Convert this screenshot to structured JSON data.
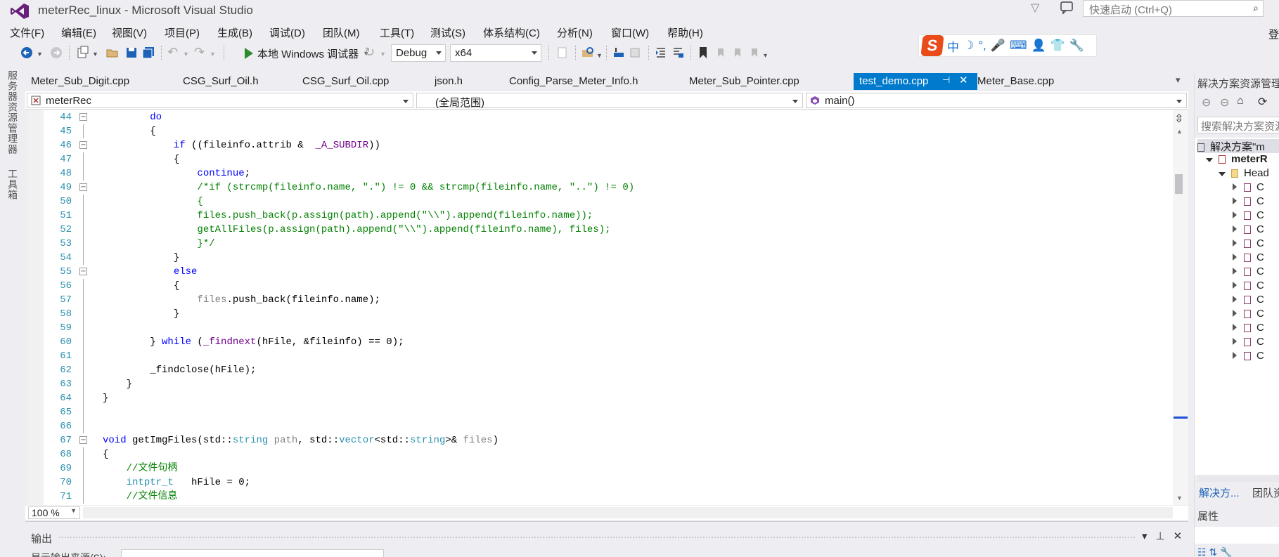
{
  "window": {
    "title": "meterRec_linux - Microsoft Visual Studio",
    "quick_launch_placeholder": "快速启动 (Ctrl+Q)",
    "account_char": "登"
  },
  "menu": [
    "文件(F)",
    "编辑(E)",
    "视图(V)",
    "项目(P)",
    "生成(B)",
    "调试(D)",
    "团队(M)",
    "工具(T)",
    "测试(S)",
    "体系结构(C)",
    "分析(N)",
    "窗口(W)",
    "帮助(H)"
  ],
  "toolbar": {
    "run_label": "本地 Windows 调试器",
    "config": "Debug",
    "platform": "x64"
  },
  "ime": {
    "logo": "S",
    "glyphs": [
      "中",
      "☽",
      "°,",
      "🎤",
      "⌨",
      "👤",
      "👕",
      "🔧"
    ]
  },
  "left_strip": {
    "server_explorer": "服务器资源管理器",
    "toolbox": "工具箱"
  },
  "doc_tabs": [
    {
      "label": "Meter_Sub_Digit.cpp",
      "active": false
    },
    {
      "label": "CSG_Surf_Oil.h",
      "active": false
    },
    {
      "label": "CSG_Surf_Oil.cpp",
      "active": false
    },
    {
      "label": "json.h",
      "active": false
    },
    {
      "label": "Config_Parse_Meter_Info.h",
      "active": false
    },
    {
      "label": "Meter_Sub_Pointer.cpp",
      "active": false
    },
    {
      "label": "test_demo.cpp",
      "active": true
    },
    {
      "label": "Meter_Base.cpp",
      "active": false
    }
  ],
  "nav_bar": {
    "project": "meterRec",
    "scope": "(全局范围)",
    "member": "main()"
  },
  "code_lines": [
    {
      "n": "44",
      "tokens": [
        [
          "kw",
          "        do"
        ]
      ]
    },
    {
      "n": "45",
      "tokens": [
        [
          "tx",
          "        {"
        ]
      ]
    },
    {
      "n": "46",
      "tokens": [
        [
          "tx",
          "            "
        ],
        [
          "kw",
          "if"
        ],
        [
          "tx",
          " ((fileinfo.attrib &  "
        ],
        [
          "mc",
          "_A_SUBDIR"
        ],
        [
          "tx",
          "))"
        ]
      ]
    },
    {
      "n": "47",
      "tokens": [
        [
          "tx",
          "            {"
        ]
      ]
    },
    {
      "n": "48",
      "tokens": [
        [
          "tx",
          "                "
        ],
        [
          "kw",
          "continue"
        ],
        [
          "tx",
          ";"
        ]
      ]
    },
    {
      "n": "49",
      "tokens": [
        [
          "cm",
          "                /*if (strcmp(fileinfo.name, \".\") != 0 && strcmp(fileinfo.name, \"..\") != 0)"
        ]
      ]
    },
    {
      "n": "50",
      "tokens": [
        [
          "cm",
          "                {"
        ]
      ]
    },
    {
      "n": "51",
      "tokens": [
        [
          "cm",
          "                files.push_back(p.assign(path).append(\"\\\\\").append(fileinfo.name));"
        ]
      ]
    },
    {
      "n": "52",
      "tokens": [
        [
          "cm",
          "                getAllFiles(p.assign(path).append(\"\\\\\").append(fileinfo.name), files);"
        ]
      ]
    },
    {
      "n": "53",
      "tokens": [
        [
          "cm",
          "                }*/"
        ]
      ]
    },
    {
      "n": "54",
      "tokens": [
        [
          "tx",
          "            }"
        ]
      ]
    },
    {
      "n": "55",
      "tokens": [
        [
          "tx",
          "            "
        ],
        [
          "kw",
          "else"
        ]
      ]
    },
    {
      "n": "56",
      "tokens": [
        [
          "tx",
          "            {"
        ]
      ]
    },
    {
      "n": "57",
      "tokens": [
        [
          "tx",
          "                "
        ],
        [
          "gr",
          "files"
        ],
        [
          "tx",
          ".push_back(fileinfo.name);"
        ]
      ]
    },
    {
      "n": "58",
      "tokens": [
        [
          "tx",
          "            }"
        ]
      ]
    },
    {
      "n": "59",
      "tokens": [
        [
          "tx",
          ""
        ]
      ]
    },
    {
      "n": "60",
      "tokens": [
        [
          "tx",
          "        } "
        ],
        [
          "kw",
          "while"
        ],
        [
          "tx",
          " ("
        ],
        [
          "mc",
          "_findnext"
        ],
        [
          "tx",
          "(hFile, &fileinfo) == 0);"
        ]
      ]
    },
    {
      "n": "61",
      "tokens": [
        [
          "tx",
          ""
        ]
      ]
    },
    {
      "n": "62",
      "tokens": [
        [
          "tx",
          "        _findclose(hFile);"
        ]
      ]
    },
    {
      "n": "63",
      "tokens": [
        [
          "tx",
          "    }"
        ]
      ]
    },
    {
      "n": "64",
      "tokens": [
        [
          "tx",
          "}"
        ]
      ]
    },
    {
      "n": "65",
      "tokens": [
        [
          "tx",
          ""
        ]
      ]
    },
    {
      "n": "66",
      "tokens": [
        [
          "tx",
          ""
        ]
      ]
    },
    {
      "n": "67",
      "tokens": [
        [
          "kw",
          "void"
        ],
        [
          "tx",
          " getImgFiles(std::"
        ],
        [
          "ty",
          "string"
        ],
        [
          "tx",
          " "
        ],
        [
          "gr",
          "path"
        ],
        [
          "tx",
          ", std::"
        ],
        [
          "ty",
          "vector"
        ],
        [
          "tx",
          "<std::"
        ],
        [
          "ty",
          "string"
        ],
        [
          "tx",
          ">& "
        ],
        [
          "gr",
          "files"
        ],
        [
          "tx",
          ")"
        ]
      ]
    },
    {
      "n": "68",
      "tokens": [
        [
          "tx",
          "{"
        ]
      ]
    },
    {
      "n": "69",
      "tokens": [
        [
          "cm",
          "    //文件句柄"
        ]
      ]
    },
    {
      "n": "70",
      "tokens": [
        [
          "tx",
          "    "
        ],
        [
          "ty",
          "intptr_t"
        ],
        [
          "tx",
          "   hFile = 0;"
        ]
      ]
    },
    {
      "n": "71",
      "tokens": [
        [
          "cm",
          "    //文件信息"
        ]
      ]
    }
  ],
  "editor": {
    "zoom": "100 %"
  },
  "output": {
    "title": "输出",
    "source_label": "显示输出来源(S):"
  },
  "solution_explorer": {
    "title": "解决方案资源管理器",
    "search_placeholder": "搜索解决方案资源",
    "solution_node": "解决方案\"m",
    "project_node": "meterR",
    "headers_node": "Head",
    "file_items": [
      "C",
      "C",
      "C",
      "C",
      "C",
      "C",
      "C",
      "C",
      "C",
      "C",
      "C",
      "C",
      "C"
    ],
    "bottom_tabs": [
      "解决方...",
      "团队资"
    ]
  },
  "properties": {
    "title": "属性"
  },
  "colors": {
    "accent": "#007acc",
    "keyword": "#0000ff",
    "comment": "#008000",
    "type": "#2b91af",
    "macro": "#6f008a"
  }
}
